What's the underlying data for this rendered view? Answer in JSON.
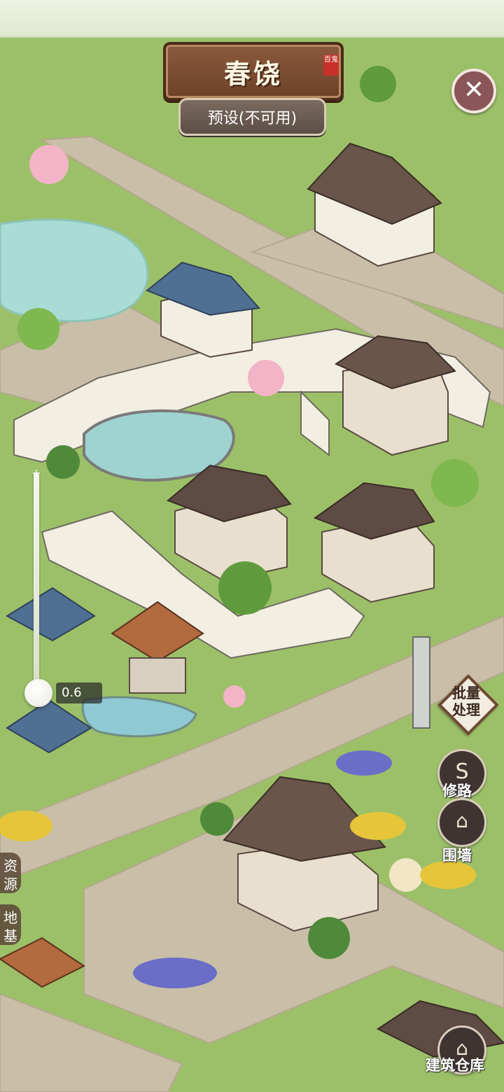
{
  "header": {
    "title": "春饶",
    "seal_text": "百鬼",
    "preset_label": "预设(不可用)",
    "close_icon": "close-icon"
  },
  "zoom": {
    "value_label": "0.6",
    "plus_icon": "zoom-plus-icon"
  },
  "right_tools": {
    "batch_label": "批量处理",
    "road_label": "修路",
    "wall_label": "围墙",
    "warehouse_label": "建筑仓库"
  },
  "left_tabs": {
    "resources_label": "资源",
    "foundation_label": "地基"
  },
  "colors": {
    "grass": "#9cc068",
    "path": "#c9bfa8",
    "roof": "#5e4b43",
    "wall": "#f2eee2",
    "water": "#a9dcd4",
    "plaque": "#7a4b31"
  }
}
